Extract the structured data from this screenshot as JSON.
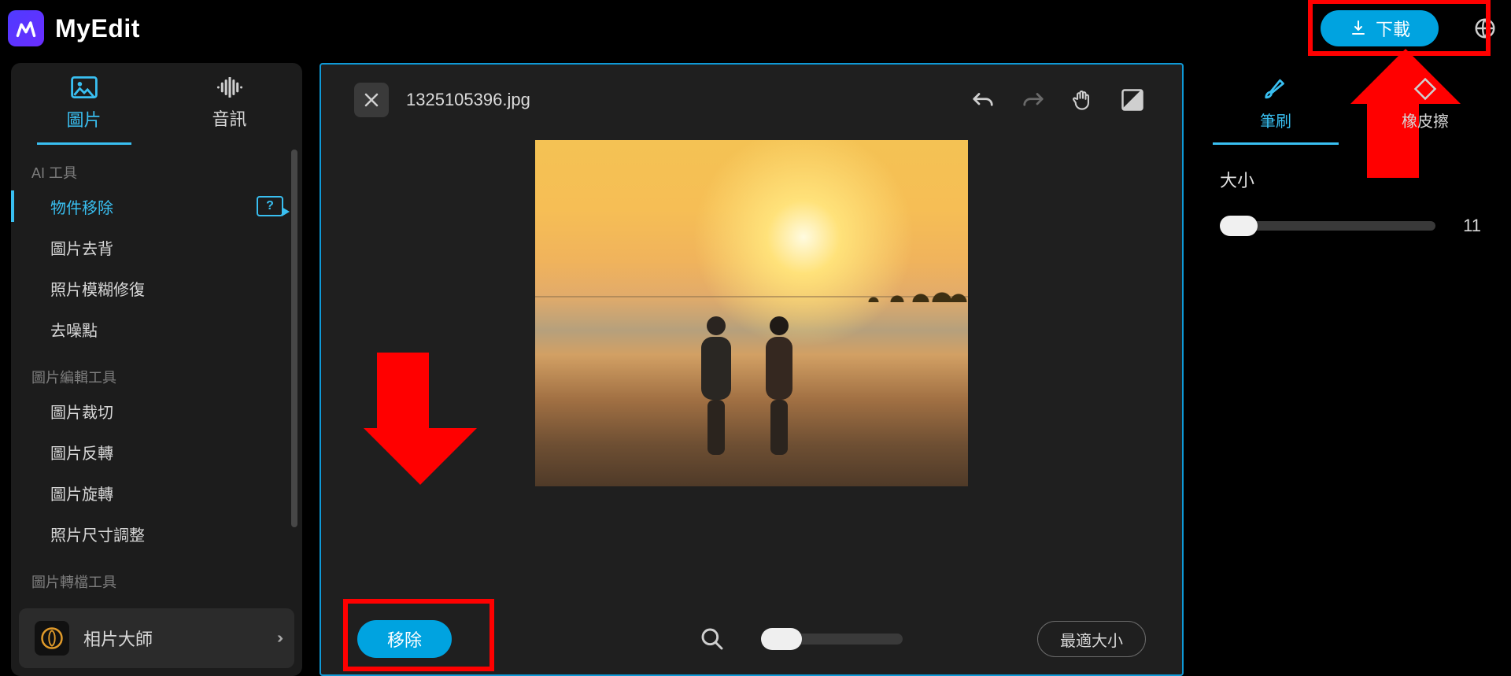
{
  "app": {
    "name": "MyEdit"
  },
  "topbar": {
    "download_label": "下載"
  },
  "sidebar": {
    "tabs": {
      "image": "圖片",
      "audio": "音訊"
    },
    "sections": {
      "ai": "AI 工具",
      "edit": "圖片編輯工具",
      "convert": "圖片轉檔工具"
    },
    "tools": {
      "object_remove": "物件移除",
      "bg_remove": "圖片去背",
      "deblur": "照片模糊修復",
      "denoise": "去噪點",
      "crop": "圖片裁切",
      "flip": "圖片反轉",
      "rotate": "圖片旋轉",
      "resize": "照片尺寸調整"
    },
    "promo": {
      "label": "相片大師"
    }
  },
  "canvas": {
    "filename": "1325105396.jpg",
    "remove_label": "移除",
    "fit_label": "最適大小"
  },
  "right": {
    "tabs": {
      "brush": "筆刷",
      "eraser": "橡皮擦"
    },
    "size_label": "大小",
    "size_value": "11"
  }
}
